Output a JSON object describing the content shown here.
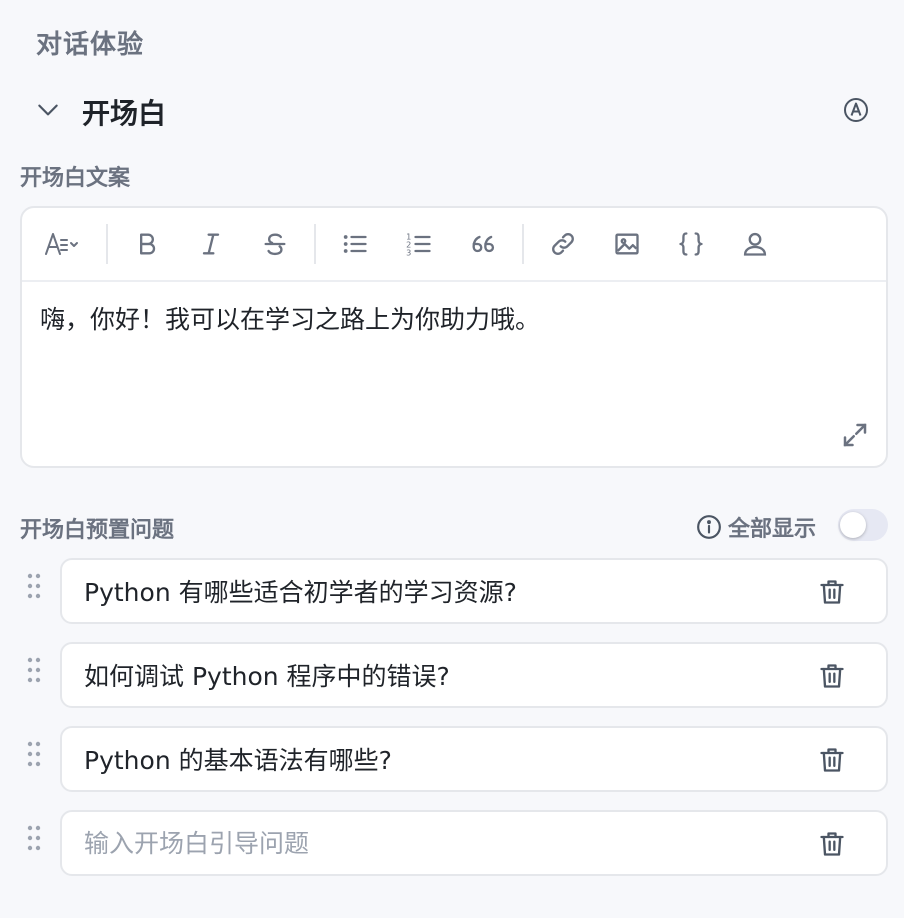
{
  "section": {
    "title": "对话体验"
  },
  "opening": {
    "collapse_title": "开场白",
    "text_label": "开场白文案",
    "toolbar": {
      "items": [
        "text-style-icon",
        "bold-icon",
        "italic-icon",
        "strikethrough-icon",
        "bullet-list-icon",
        "numbered-list-icon",
        "quote-icon",
        "link-icon",
        "image-icon",
        "code-block-icon",
        "user-icon"
      ]
    },
    "content": "嗨，你好！我可以在学习之路上为你助力哦。"
  },
  "preset": {
    "label": "开场白预置问题",
    "show_all_label": "全部显示",
    "show_all_enabled": false,
    "questions": [
      "Python 有哪些适合初学者的学习资源?",
      "如何调试 Python 程序中的错误?",
      "Python 的基本语法有哪些?"
    ],
    "new_placeholder": "输入开场白引导问题"
  }
}
